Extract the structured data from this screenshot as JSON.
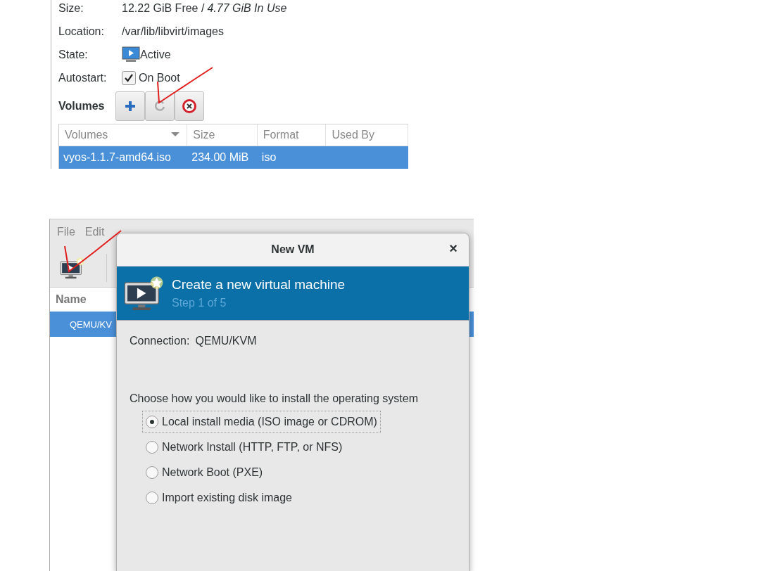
{
  "pool": {
    "fields": [
      {
        "kind": "text",
        "label": "Size:",
        "value": "12.22 GiB Free / *4.77 GiB In Use*"
      },
      {
        "kind": "text",
        "label": "Location:",
        "value": "/var/lib/libvirt/images"
      },
      {
        "kind": "state",
        "label": "State:",
        "value": "Active"
      },
      {
        "kind": "checkbox",
        "label": "Autostart:",
        "value": "On Boot",
        "checked": true
      }
    ],
    "volumes_label": "Volumes",
    "table": {
      "columns": [
        "Volumes",
        "Size",
        "Format",
        "Used By"
      ],
      "rows": [
        {
          "cells": [
            "vyos-1.1.7-amd64.iso",
            "234.00 MiB",
            "iso",
            ""
          ],
          "selected": true
        }
      ]
    }
  },
  "manager": {
    "menu": [
      "File",
      "Edit"
    ],
    "list_header": "Name",
    "rows": [
      {
        "name": "QEMU/KV",
        "selected": true
      }
    ]
  },
  "dialog": {
    "title": "New VM",
    "close": "×",
    "banner_title": "Create a new virtual machine",
    "step": "Step 1 of 5",
    "connection_label": "Connection:",
    "connection_value": "QEMU/KVM",
    "prompt": "Choose how you would like to install the operating system",
    "options": [
      {
        "label": "Local install media (ISO image or CDROM)",
        "selected": true,
        "focused": true
      },
      {
        "label": "Network Install (HTTP, FTP, or NFS)",
        "selected": false,
        "focused": false
      },
      {
        "label": "Network Boot (PXE)",
        "selected": false,
        "focused": false
      },
      {
        "label": "Import existing disk image",
        "selected": false,
        "focused": false
      }
    ]
  }
}
